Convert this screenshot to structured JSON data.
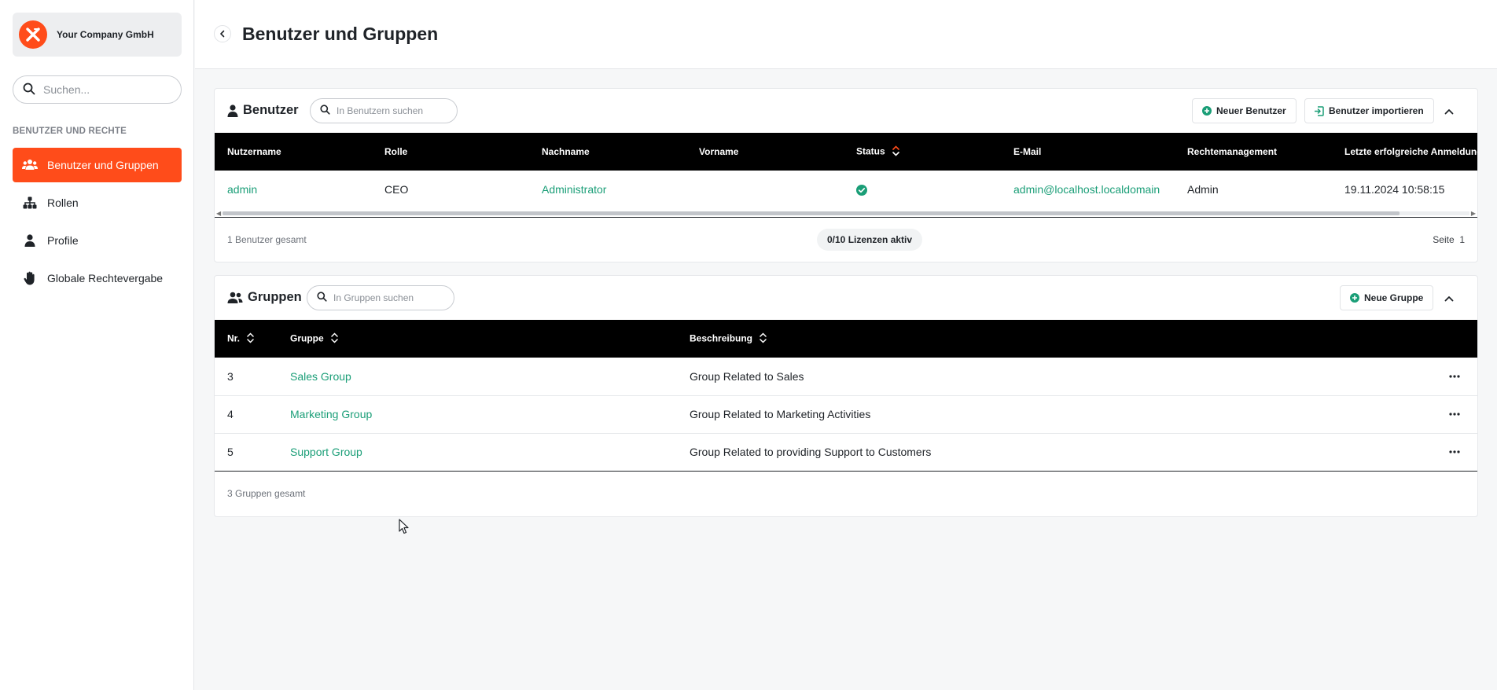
{
  "sidebar": {
    "company_name": "Your Company GmbH",
    "search_placeholder": "Suchen...",
    "section_label": "BENUTZER UND RECHTE",
    "items": [
      {
        "label": "Benutzer und Gruppen",
        "icon": "users-icon",
        "active": true
      },
      {
        "label": "Rollen",
        "icon": "hierarchy-icon",
        "active": false
      },
      {
        "label": "Profile",
        "icon": "person-icon",
        "active": false
      },
      {
        "label": "Globale Rechtevergabe",
        "icon": "hand-icon",
        "active": false
      }
    ]
  },
  "header": {
    "title": "Benutzer und Gruppen"
  },
  "users": {
    "title": "Benutzer",
    "search_placeholder": "In Benutzern suchen",
    "new_button": "Neuer Benutzer",
    "import_button": "Benutzer importieren",
    "columns": [
      "Nutzername",
      "Rolle",
      "Nachname",
      "Vorname",
      "Status",
      "E-Mail",
      "Rechtemanagement",
      "Letzte erfolgreiche Anmeldung"
    ],
    "rows": [
      {
        "username": "admin",
        "role": "CEO",
        "lastname": "Administrator",
        "firstname": "",
        "status": "active",
        "email": "admin@localhost.localdomain",
        "rights": "Admin",
        "last_login": "19.11.2024 10:58:15"
      }
    ],
    "total": "1 Benutzer gesamt",
    "licenses": "0/10 Lizenzen aktiv",
    "page_label": "Seite",
    "page": "1"
  },
  "groups": {
    "title": "Gruppen",
    "search_placeholder": "In Gruppen suchen",
    "new_button": "Neue Gruppe",
    "columns": [
      "Nr.",
      "Gruppe",
      "Beschreibung"
    ],
    "rows": [
      {
        "nr": "3",
        "name": "Sales Group",
        "description": "Group Related to Sales"
      },
      {
        "nr": "4",
        "name": "Marketing Group",
        "description": "Group Related to Marketing Activities"
      },
      {
        "nr": "5",
        "name": "Support Group",
        "description": "Group Related to providing Support to Customers"
      }
    ],
    "total": "3 Gruppen gesamt"
  },
  "colors": {
    "accent": "#ff4c1a",
    "link": "#1a9e77",
    "header_bg": "#000000"
  }
}
